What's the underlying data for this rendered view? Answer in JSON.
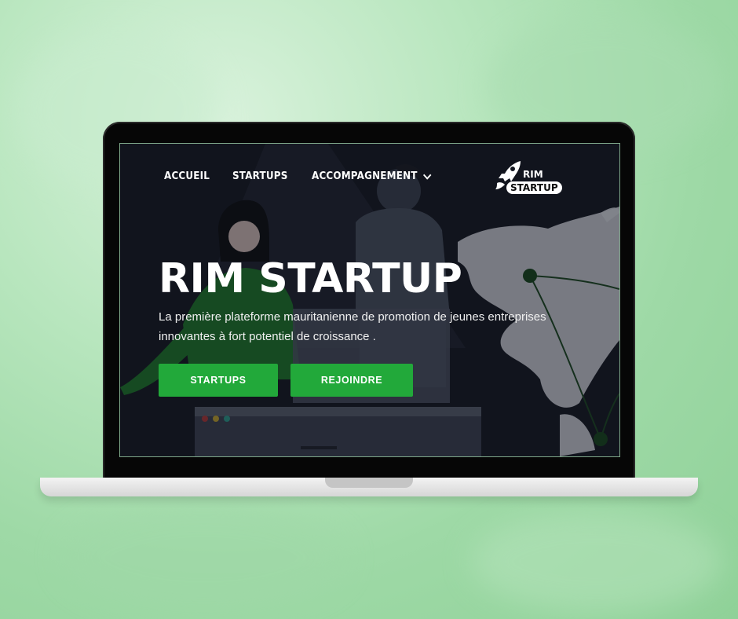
{
  "nav": {
    "items": [
      {
        "label": "ACCUEIL"
      },
      {
        "label": "STARTUPS"
      },
      {
        "label": "ACCOMPAGNEMENT",
        "has_dropdown": true
      }
    ]
  },
  "logo": {
    "line1": "RIM",
    "line2": "STARTUP"
  },
  "hero": {
    "title": "RIM STARTUP",
    "subtitle": "La première plateforme mauritanienne de promotion de jeunes entreprises innovantes à fort potentiel de croissance ."
  },
  "buttons": {
    "startups_label": "STARTUPS",
    "join_label": "REJOINDRE"
  },
  "colors": {
    "accent": "#22a93a",
    "screen_bg": "#141822",
    "page_bg": "#b8e6be"
  },
  "icons": {
    "dropdown": "chevron-down-icon",
    "logo": "rocket-icon"
  }
}
